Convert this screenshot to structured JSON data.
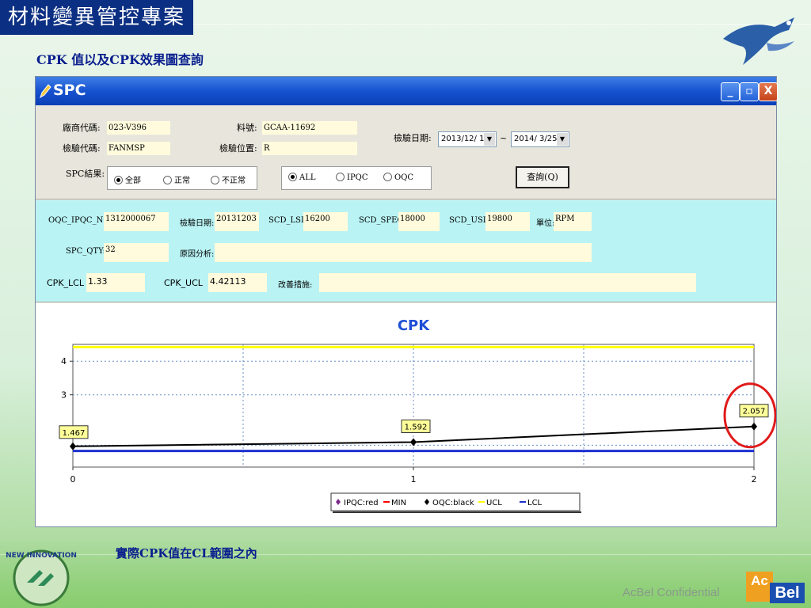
{
  "slide": {
    "title": "材料變異管控專案",
    "subtitle": "CPK  值以及CPK效果圖查詢",
    "note": "實際CPK值在CL範圍之內",
    "confidential": "AcBel Confidential",
    "logo_text_ac": "Ac",
    "logo_text_bel": "Bel",
    "eagle_text": "The Spirit of The Eagle",
    "left_logo_text": "NEW INNOVATION"
  },
  "window": {
    "title": "SPC",
    "min": "_",
    "max": "▫",
    "close": "X"
  },
  "query": {
    "vendor_code_label": "廠商代碼:",
    "vendor_code": "023-V396",
    "part_no_label": "料號:",
    "part_no": "GCAA-11692",
    "inspector_code_label": "檢驗代碼:",
    "inspector_code": "FANMSP",
    "location_label": "檢驗位置:",
    "location": "R",
    "date_label": "檢驗日期:",
    "date_from": "2013/12/ 1",
    "date_sep": "~",
    "date_to": "2014/ 3/25",
    "spc_result_label": "SPC結果:",
    "result_options": [
      "全部",
      "正常",
      "不正常"
    ],
    "source_options": [
      "ALL",
      "IPQC",
      "OQC"
    ],
    "query_button": "查詢(Q)"
  },
  "detail": {
    "oqc_no_label": "OQC_IPQC_NO:",
    "oqc_no": "1312000067",
    "insp_date_label": "檢驗日期:",
    "insp_date": "20131203",
    "lsl_label": "SCD_LSL:",
    "lsl": "16200",
    "spec_label": "SCD_SPEC:",
    "spec": "18000",
    "usl_label": "SCD_USL:",
    "usl": "19800",
    "unit_label": "單位:",
    "unit": "RPM",
    "qty_label": "SPC_QTY:",
    "qty": "32",
    "cause_label": "原因分析:",
    "cause": "",
    "cpk_lcl_label": "CPK_LCL",
    "cpk_lcl": "1.33",
    "cpk_ucl_label": "CPK_UCL",
    "cpk_ucl": "4.42113",
    "improve_label": "改善措施:",
    "improve": ""
  },
  "chart_data": {
    "type": "line",
    "title": "CPK",
    "x": [
      0,
      1,
      2
    ],
    "xlim": [
      0,
      2
    ],
    "ylim": [
      0.85,
      4.5
    ],
    "yticks": [
      3,
      4
    ],
    "xticks": [
      0,
      1,
      2
    ],
    "series": [
      {
        "name": "IPQC:red",
        "color": "#7a2a8a",
        "values": []
      },
      {
        "name": "MIN",
        "color": "#ff0000",
        "values": []
      },
      {
        "name": "OQC:black",
        "color": "#000000",
        "values": [
          1.467,
          1.592,
          2.057
        ]
      },
      {
        "name": "UCL",
        "color": "#ffff00",
        "values": [
          4.42113,
          4.42113,
          4.42113
        ]
      },
      {
        "name": "LCL",
        "color": "#1e2fd0",
        "values": [
          1.33,
          1.33,
          1.33
        ]
      }
    ],
    "data_labels": [
      "1.467",
      "1.592",
      "2.057"
    ],
    "grid": true,
    "legend_position": "bottom-center"
  },
  "colors": {
    "title_bg": "#0b2f82",
    "window_title": "#1752cf",
    "detail_bg": "#b9f3f4",
    "field_bg": "#fffbdc",
    "highlight_circle": "#e01a1a"
  }
}
